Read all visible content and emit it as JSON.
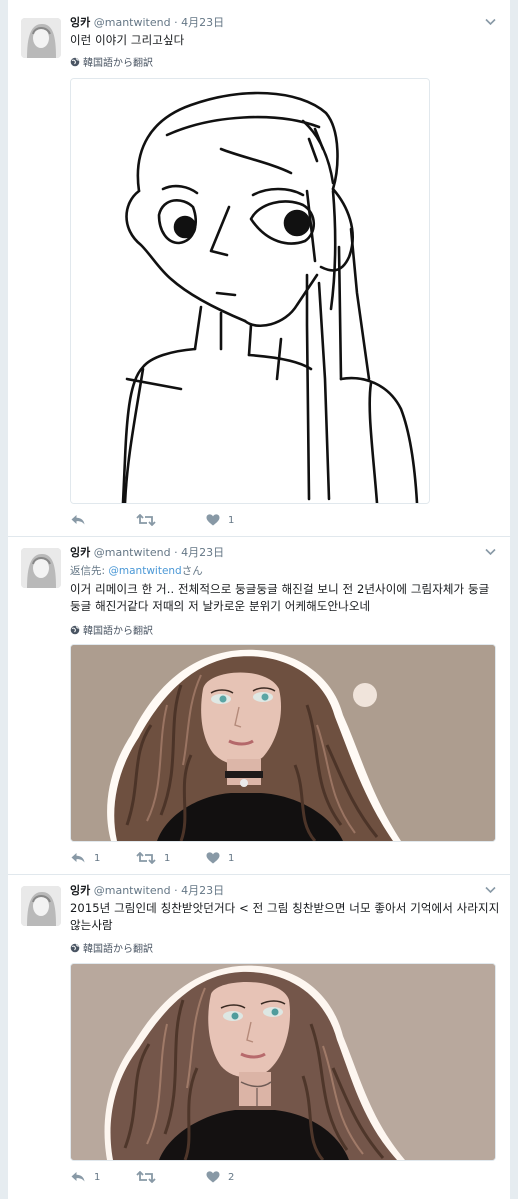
{
  "colors": {
    "link": "#4b98d6",
    "background": "#e6ecf0",
    "icon": "#8899a6"
  },
  "tweets": [
    {
      "name": "잉카",
      "handle": "@mantwitend",
      "dot": "·",
      "date": "4月23日",
      "text": "이런 이야기 그리고싶다",
      "translate": "韓国語から翻訳",
      "actions": {
        "reply": "",
        "retweet": "",
        "like": "1"
      }
    },
    {
      "name": "잉카",
      "handle": "@mantwitend",
      "dot": "·",
      "date": "4月23日",
      "reply_prefix": "返信先:",
      "reply_handle": "@mantwitend",
      "reply_suffix": "さん",
      "text": "이거 리메이크 한 거.. 전체적으로 둥글둥글 해진걸 보니 전 2년사이에 그림자체가 둥글둥글 해진거같다 저때의 저 날카로운 분위기 어케해도안나오네",
      "translate": "韓国語から翻訳",
      "actions": {
        "reply": "1",
        "retweet": "1",
        "like": "1"
      }
    },
    {
      "name": "잉카",
      "handle": "@mantwitend",
      "dot": "·",
      "date": "4月23日",
      "text": "2015년 그림인데 칭찬받앗던거다 < 전 그림 칭찬받으면 너모 좋아서 기억에서 사라지지않는사람",
      "translate": "韓国語から翻訳",
      "actions": {
        "reply": "1",
        "retweet": "",
        "like": "2"
      }
    }
  ]
}
